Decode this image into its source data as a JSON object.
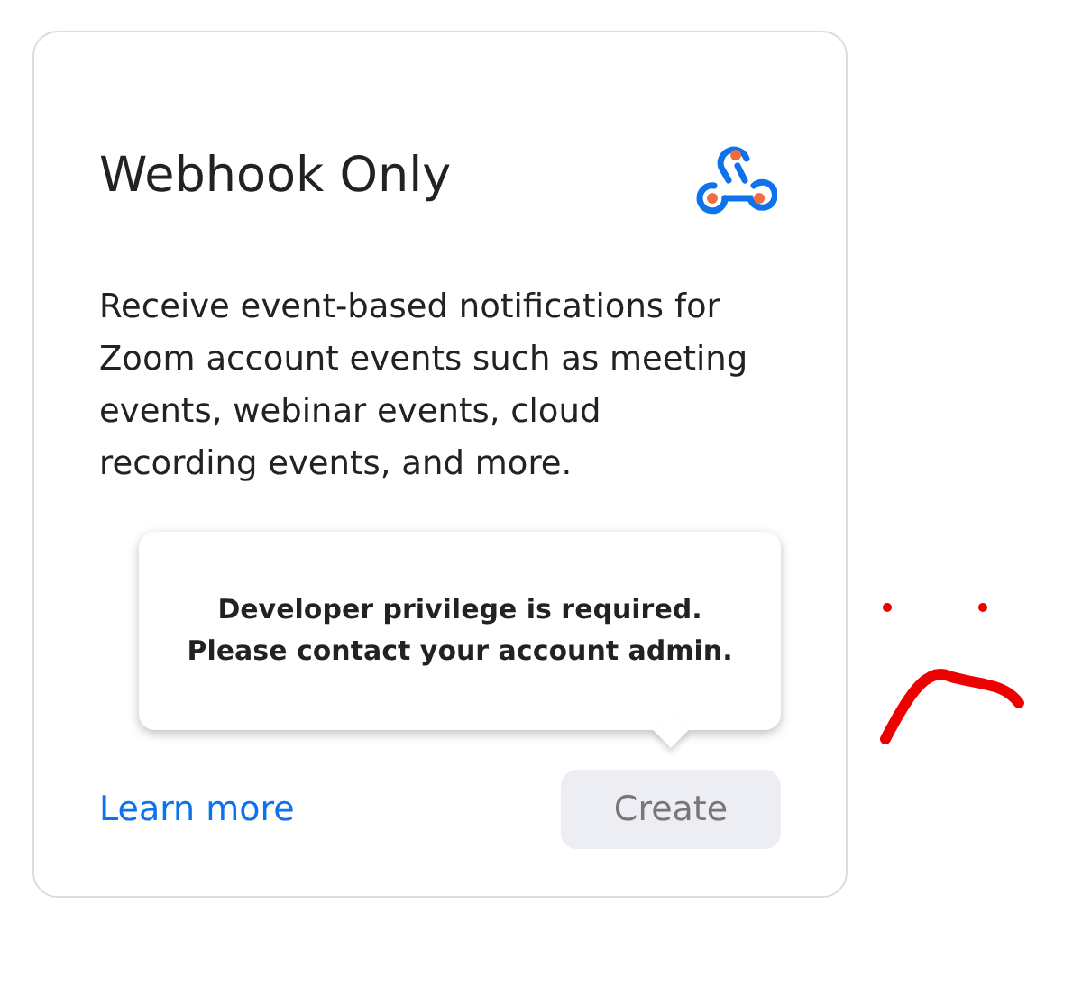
{
  "card": {
    "title": "Webhook Only",
    "description": "Receive event-based notifications for Zoom account events such as meeting events, webinar events, cloud recording events, and more.",
    "tooltip": {
      "lines": [
        "Developer privilege is required.",
        "Please contact your account admin."
      ]
    },
    "link": "Learn more",
    "button": {
      "label": "Create",
      "disabled": true
    }
  }
}
